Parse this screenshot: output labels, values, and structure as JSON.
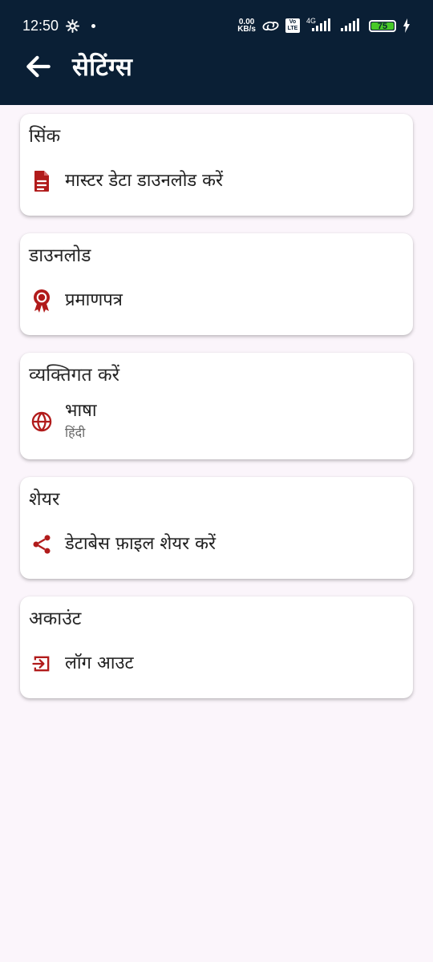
{
  "status_bar": {
    "time": "12:50",
    "network_speed": "0.00",
    "network_unit": "KB/s",
    "battery_level": "75",
    "network_type": "4G",
    "volte_top": "Vo",
    "volte_bottom": "LTE"
  },
  "app_bar": {
    "title": "सेटिंग्स"
  },
  "sections": [
    {
      "title": "सिंक",
      "item": "मास्टर डेटा डाउनलोड करें"
    },
    {
      "title": "डाउनलोड",
      "item": "प्रमाणपत्र"
    },
    {
      "title": "व्यक्तिगत करें",
      "item": "भाषा",
      "subtext": "हिंदी"
    },
    {
      "title": "शेयर",
      "item": "डेटाबेस फ़ाइल शेयर करें"
    },
    {
      "title": "अकाउंट",
      "item": "लॉग आउट"
    }
  ],
  "colors": {
    "header_background": "#0a1f35",
    "page_background": "#fbf5fb",
    "icon_red": "#b11b1b",
    "battery_green": "#48c928"
  }
}
